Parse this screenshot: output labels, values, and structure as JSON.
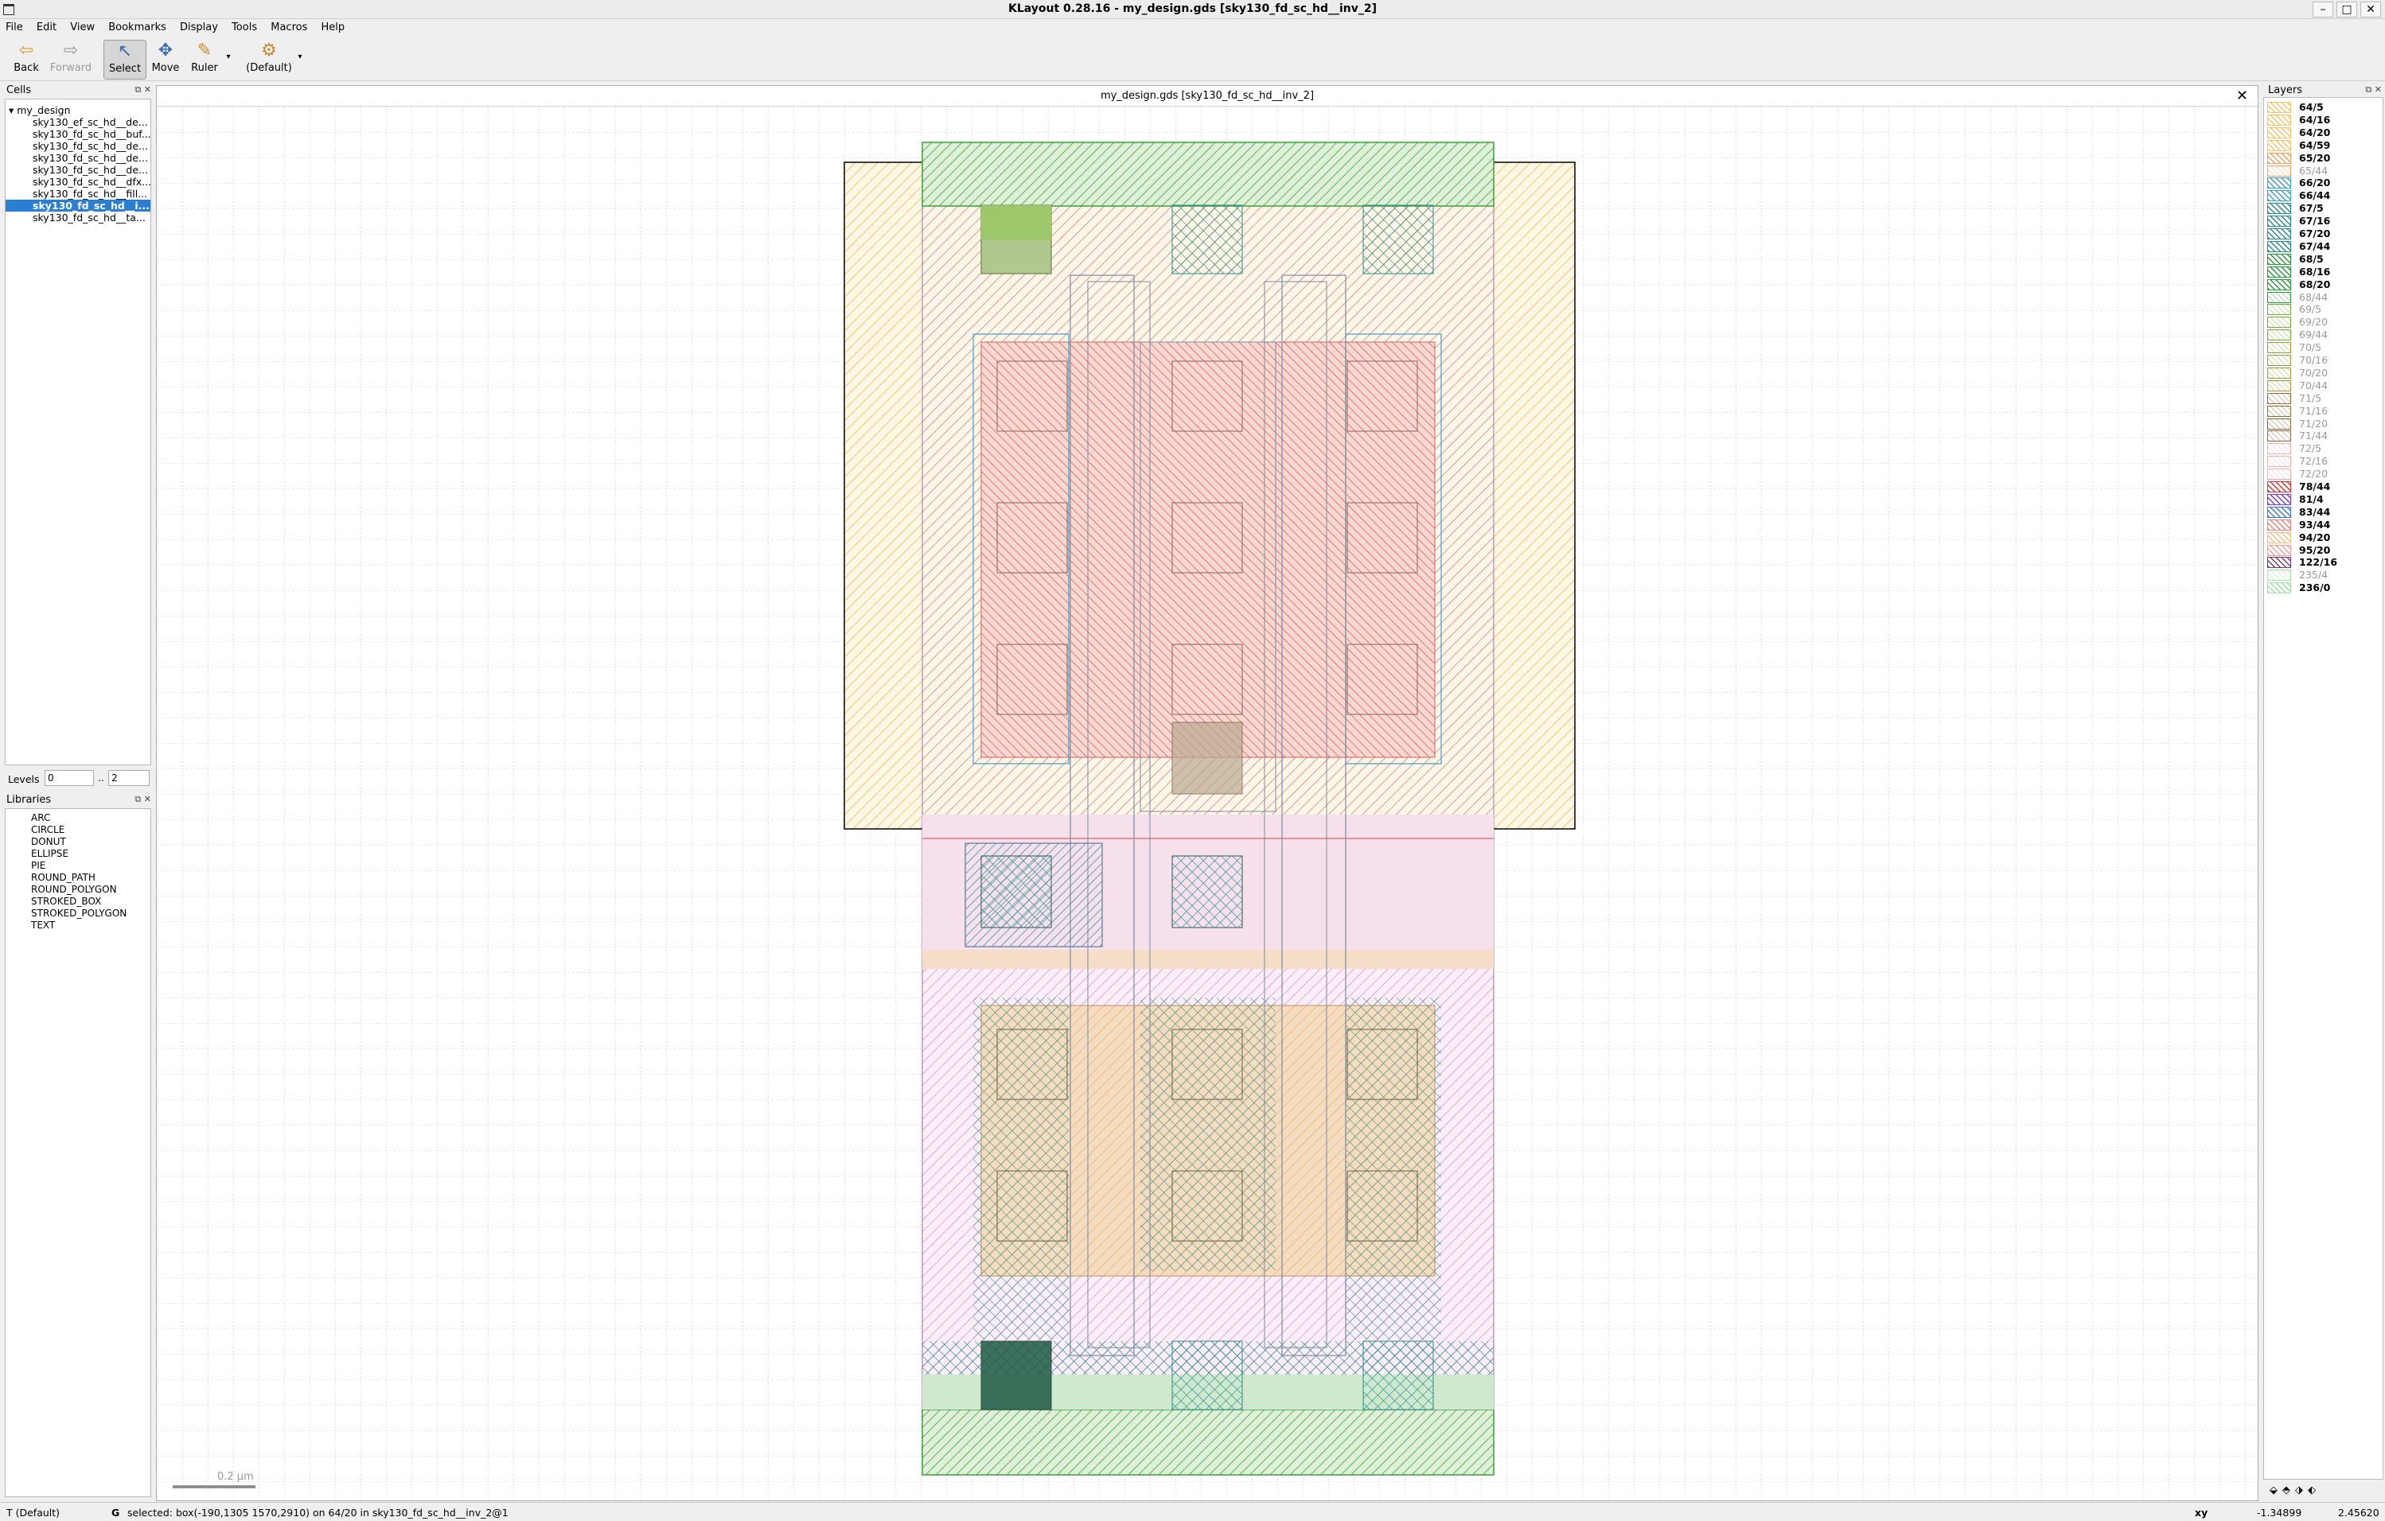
{
  "window": {
    "title": "KLayout 0.28.16 - my_design.gds [sky130_fd_sc_hd__inv_2]"
  },
  "menu": [
    "File",
    "Edit",
    "View",
    "Bookmarks",
    "Display",
    "Tools",
    "Macros",
    "Help"
  ],
  "toolbar": {
    "back": "Back",
    "forward": "Forward",
    "select": "Select",
    "move": "Move",
    "ruler": "Ruler",
    "default": "(Default)"
  },
  "cells": {
    "title": "Cells",
    "root": "my_design",
    "items": [
      "sky130_ef_sc_hd__de...",
      "sky130_fd_sc_hd__buf...",
      "sky130_fd_sc_hd__de...",
      "sky130_fd_sc_hd__de...",
      "sky130_fd_sc_hd__de...",
      "sky130_fd_sc_hd__dfx...",
      "sky130_fd_sc_hd__fill...",
      "sky130_fd_sc_hd__i...",
      "sky130_fd_sc_hd__ta..."
    ],
    "selected_index": 7
  },
  "levels": {
    "label": "Levels",
    "from": "0",
    "sep": "..",
    "to": "2"
  },
  "libraries": {
    "title": "Libraries",
    "items": [
      "ARC",
      "CIRCLE",
      "DONUT",
      "ELLIPSE",
      "PIE",
      "ROUND_PATH",
      "ROUND_POLYGON",
      "STROKED_BOX",
      "STROKED_POLYGON",
      "TEXT"
    ]
  },
  "layers": {
    "title": "Layers",
    "items": [
      {
        "name": "64/5",
        "color": "#f2c66d",
        "visible": true
      },
      {
        "name": "64/16",
        "color": "#f2c66d",
        "visible": true
      },
      {
        "name": "64/20",
        "color": "#f2c66d",
        "visible": true
      },
      {
        "name": "64/59",
        "color": "#f2c66d",
        "visible": true
      },
      {
        "name": "65/20",
        "color": "#f0a060",
        "visible": true
      },
      {
        "name": "65/44",
        "color": "#f0a060",
        "visible": false
      },
      {
        "name": "66/20",
        "color": "#3b9fc9",
        "visible": true
      },
      {
        "name": "66/44",
        "color": "#3b9fc9",
        "visible": true
      },
      {
        "name": "67/5",
        "color": "#2a8a8a",
        "visible": true
      },
      {
        "name": "67/16",
        "color": "#2a8a8a",
        "visible": true
      },
      {
        "name": "67/20",
        "color": "#2a8a8a",
        "visible": true
      },
      {
        "name": "67/44",
        "color": "#2a8a8a",
        "visible": true
      },
      {
        "name": "68/5",
        "color": "#2a9a3a",
        "visible": true
      },
      {
        "name": "68/16",
        "color": "#2a9a3a",
        "visible": true
      },
      {
        "name": "68/20",
        "color": "#2a9a3a",
        "visible": true
      },
      {
        "name": "68/44",
        "color": "#2a9a3a",
        "visible": false
      },
      {
        "name": "69/5",
        "color": "#7aa83a",
        "visible": false
      },
      {
        "name": "69/20",
        "color": "#7aa83a",
        "visible": false
      },
      {
        "name": "69/44",
        "color": "#7aa83a",
        "visible": false
      },
      {
        "name": "70/5",
        "color": "#9a9a3a",
        "visible": false
      },
      {
        "name": "70/16",
        "color": "#9a9a3a",
        "visible": false
      },
      {
        "name": "70/20",
        "color": "#9a9a3a",
        "visible": false
      },
      {
        "name": "70/44",
        "color": "#9a9a3a",
        "visible": false
      },
      {
        "name": "71/5",
        "color": "#8a6a3a",
        "visible": false
      },
      {
        "name": "71/16",
        "color": "#8a6a3a",
        "visible": false
      },
      {
        "name": "71/20",
        "color": "#8a6a3a",
        "visible": false
      },
      {
        "name": "71/44",
        "color": "#8a6a3a",
        "visible": false
      },
      {
        "name": "72/5",
        "color": "#f0b0b0",
        "visible": false
      },
      {
        "name": "72/16",
        "color": "#f0b0b0",
        "visible": false
      },
      {
        "name": "72/20",
        "color": "#f0b0b0",
        "visible": false
      },
      {
        "name": "78/44",
        "color": "#e03030",
        "visible": true
      },
      {
        "name": "81/4",
        "color": "#7a3ad0",
        "visible": true
      },
      {
        "name": "83/44",
        "color": "#3a7ae0",
        "visible": true
      },
      {
        "name": "93/44",
        "color": "#f08080",
        "visible": true
      },
      {
        "name": "94/20",
        "color": "#f2c080",
        "visible": true
      },
      {
        "name": "95/20",
        "color": "#f0a0a0",
        "visible": true
      },
      {
        "name": "122/16",
        "color": "#7a3a7a",
        "visible": true
      },
      {
        "name": "235/4",
        "color": "#a0e0a0",
        "visible": false
      },
      {
        "name": "236/0",
        "color": "#a0e0a0",
        "visible": true
      }
    ]
  },
  "view": {
    "title": "my_design.gds [sky130_fd_sc_hd__inv_2]",
    "scale_label": "0.2 µm"
  },
  "status": {
    "mode": "T (Default)",
    "grid": "G",
    "message": "selected: box(-190,1305 1570,2910) on 64/20 in sky130_fd_sc_hd__inv_2@1",
    "coord_mode": "xy",
    "x": "-1.34899",
    "y": "2.45620"
  },
  "colors": {
    "nwell": "#f2c66d",
    "poly": "#e03030",
    "li": "#7a3ad0",
    "licon": "#2a5a5a",
    "met1": "#3b9fc9",
    "diff": "#2a9a3a",
    "pwell": "#a0e0a0",
    "selection": "#2a7fd4"
  }
}
